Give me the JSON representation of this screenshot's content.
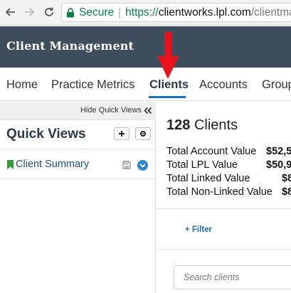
{
  "browser": {
    "secure_label": "Secure",
    "url_scheme": "https://",
    "url_host": "clientworks.lpl.com",
    "url_path": "/clientman"
  },
  "app": {
    "title": "Client Management"
  },
  "main_nav": {
    "items": [
      {
        "label": "Home"
      },
      {
        "label": "Practice Metrics"
      },
      {
        "label": "Clients"
      },
      {
        "label": "Accounts"
      },
      {
        "label": "Group"
      }
    ],
    "active": "Clients"
  },
  "sidebar": {
    "hide_label": "Hide Quick Views",
    "title": "Quick Views",
    "items": [
      {
        "label": "Client Summary"
      }
    ]
  },
  "main": {
    "client_count": "128",
    "client_count_label": "Clients",
    "summary": [
      {
        "label": "Total Account Value",
        "value": "$52,5"
      },
      {
        "label": "Total LPL Value",
        "value": "$50,9"
      },
      {
        "label": "Total Linked Value",
        "value": "$8"
      },
      {
        "label": "Total Non-Linked Value",
        "value": "$8"
      }
    ],
    "filter_label": "+ Filter",
    "search_placeholder": "Search clients"
  },
  "colors": {
    "header_bg": "#3f4e5c",
    "accent": "#1a75bb",
    "secure_green": "#0b8043",
    "annotation_red": "#e8101a"
  }
}
